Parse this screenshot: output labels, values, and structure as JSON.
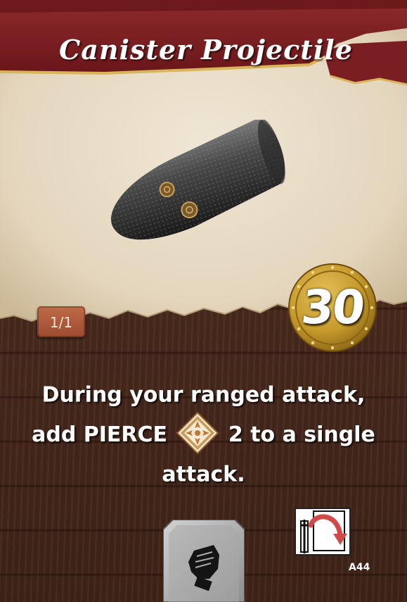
{
  "card": {
    "title": "Canister Projectile",
    "count": "1/1",
    "cost": "30",
    "ability_line1": "During your ranged attack,",
    "ability_line2_before": "add PIERCE",
    "ability_line2_after": "2 to a single",
    "ability_line3": "attack.",
    "slot": "hand-slot-icon",
    "usage": "consumed-icon",
    "code": "A44"
  },
  "colors": {
    "banner": "#7a1e22",
    "banner_trim": "#d8b45a",
    "parchment": "#e7dbc6",
    "coin": "#c9a02e",
    "badge": "#b05a3b",
    "wood": "#4a2a1d"
  }
}
